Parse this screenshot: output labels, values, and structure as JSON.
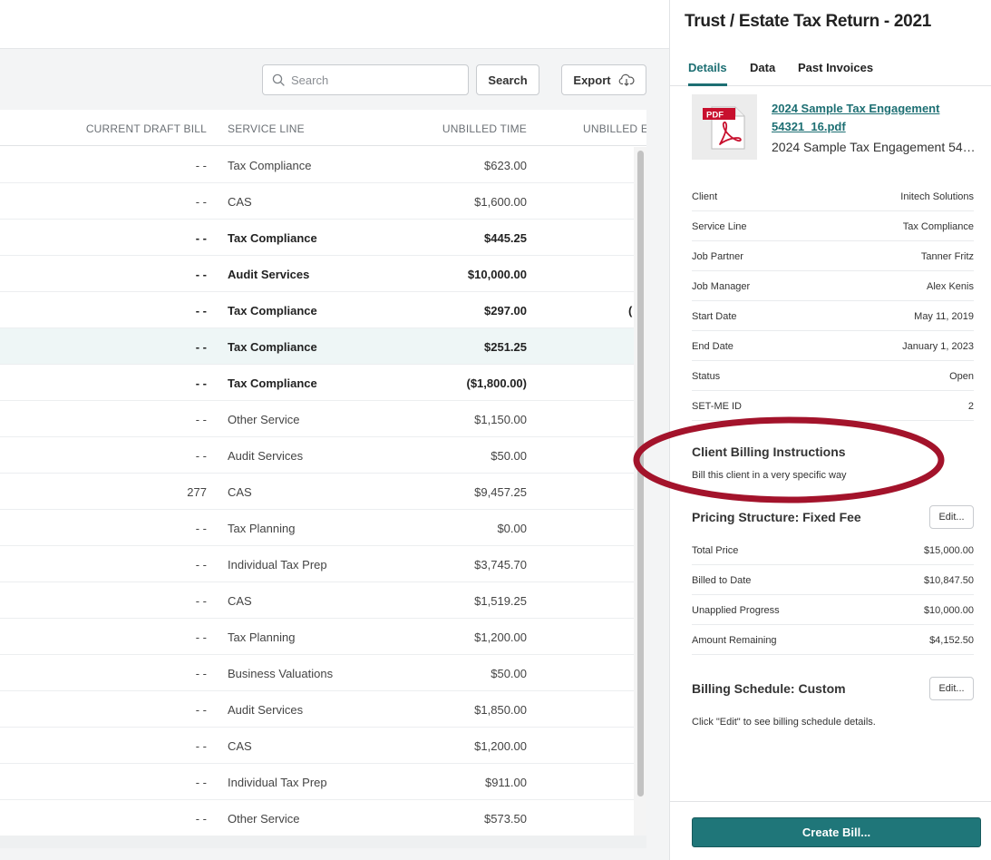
{
  "toolbar": {
    "search_placeholder": "Search",
    "search_button": "Search",
    "export_button": "Export"
  },
  "table": {
    "headers": {
      "current_draft_bill": "CURRENT DRAFT BILL",
      "service_line": "SERVICE LINE",
      "unbilled_time": "UNBILLED TIME",
      "unbilled_e": "UNBILLED E"
    },
    "rows": [
      {
        "draft": "- -",
        "service": "Tax Compliance",
        "unbilled": "$623.00",
        "extra": "",
        "bold": false
      },
      {
        "draft": "- -",
        "service": "CAS",
        "unbilled": "$1,600.00",
        "extra": "",
        "bold": false
      },
      {
        "draft": "- -",
        "service": "Tax Compliance",
        "unbilled": "$445.25",
        "extra": "",
        "bold": true
      },
      {
        "draft": "- -",
        "service": "Audit Services",
        "unbilled": "$10,000.00",
        "extra": "",
        "bold": true
      },
      {
        "draft": "- -",
        "service": "Tax Compliance",
        "unbilled": "$297.00",
        "extra": "(",
        "bold": true
      },
      {
        "draft": "- -",
        "service": "Tax Compliance",
        "unbilled": "$251.25",
        "extra": "",
        "bold": true,
        "highlight": true
      },
      {
        "draft": "- -",
        "service": "Tax Compliance",
        "unbilled": "($1,800.00)",
        "extra": "",
        "bold": true
      },
      {
        "draft": "- -",
        "service": "Other Service",
        "unbilled": "$1,150.00",
        "extra": "",
        "bold": false
      },
      {
        "draft": "- -",
        "service": "Audit Services",
        "unbilled": "$50.00",
        "extra": "",
        "bold": false
      },
      {
        "draft": "277",
        "service": "CAS",
        "unbilled": "$9,457.25",
        "extra": "",
        "bold": false
      },
      {
        "draft": "- -",
        "service": "Tax Planning",
        "unbilled": "$0.00",
        "extra": "",
        "bold": false
      },
      {
        "draft": "- -",
        "service": "Individual Tax Prep",
        "unbilled": "$3,745.70",
        "extra": "",
        "bold": false
      },
      {
        "draft": "- -",
        "service": "CAS",
        "unbilled": "$1,519.25",
        "extra": "",
        "bold": false
      },
      {
        "draft": "- -",
        "service": "Tax Planning",
        "unbilled": "$1,200.00",
        "extra": "",
        "bold": false
      },
      {
        "draft": "- -",
        "service": "Business Valuations",
        "unbilled": "$50.00",
        "extra": "",
        "bold": false
      },
      {
        "draft": "- -",
        "service": "Audit Services",
        "unbilled": "$1,850.00",
        "extra": "",
        "bold": false
      },
      {
        "draft": "- -",
        "service": "CAS",
        "unbilled": "$1,200.00",
        "extra": "",
        "bold": false
      },
      {
        "draft": "- -",
        "service": "Individual Tax Prep",
        "unbilled": "$911.00",
        "extra": "",
        "bold": false
      },
      {
        "draft": "- -",
        "service": "Other Service",
        "unbilled": "$573.50",
        "extra": "",
        "bold": false
      }
    ]
  },
  "panel": {
    "title": "Trust / Estate Tax Return - 2021",
    "tabs": [
      {
        "label": "Details",
        "active": true
      },
      {
        "label": "Data",
        "active": false
      },
      {
        "label": "Past Invoices",
        "active": false
      }
    ],
    "file": {
      "thumb_label": "PDF",
      "link": "2024 Sample Tax Engagement 54321_16.pdf",
      "name": "2024 Sample Tax Engagement 54321_16.pdf"
    },
    "details": [
      {
        "key": "Client",
        "value": "Initech Solutions"
      },
      {
        "key": "Service Line",
        "value": "Tax Compliance"
      },
      {
        "key": "Job Partner",
        "value": "Tanner Fritz"
      },
      {
        "key": "Job Manager",
        "value": "Alex Kenis"
      },
      {
        "key": "Start Date",
        "value": "May 11, 2019"
      },
      {
        "key": "End Date",
        "value": "January 1, 2023"
      },
      {
        "key": "Status",
        "value": "Open"
      },
      {
        "key": "SET-ME ID",
        "value": "2"
      }
    ],
    "client_billing": {
      "title": "Client Billing Instructions",
      "text": "Bill this client in a very specific way"
    },
    "pricing": {
      "title": "Pricing Structure: Fixed Fee",
      "edit_label": "Edit...",
      "rows": [
        {
          "key": "Total Price",
          "value": "$15,000.00"
        },
        {
          "key": "Billed to Date",
          "value": "$10,847.50"
        },
        {
          "key": "Unapplied Progress",
          "value": "$10,000.00"
        },
        {
          "key": "Amount Remaining",
          "value": "$4,152.50"
        }
      ]
    },
    "billing_schedule": {
      "title": "Billing Schedule: Custom",
      "edit_label": "Edit...",
      "text": "Click \"Edit\" to see billing schedule details."
    },
    "create_bill": "Create Bill..."
  },
  "colors": {
    "accent": "#1d6f73",
    "button_primary": "#1f7679",
    "annotation_ellipse": "#a3132b",
    "row_highlight": "#eef6f6"
  }
}
